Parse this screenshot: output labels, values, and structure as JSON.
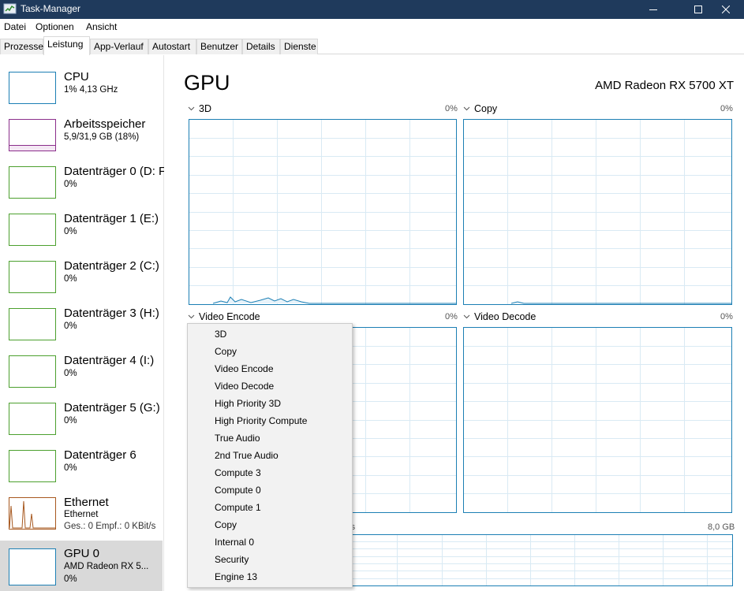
{
  "window": {
    "title": "Task-Manager"
  },
  "menu": [
    "Datei",
    "Optionen",
    "Ansicht"
  ],
  "tabs": [
    "Prozesse",
    "Leistung",
    "App-Verlauf",
    "Autostart",
    "Benutzer",
    "Details",
    "Dienste"
  ],
  "active_tab": "Leistung",
  "sidebar": [
    {
      "title": "CPU",
      "sub": "1% 4,13 GHz",
      "color": "#1c7fb4"
    },
    {
      "title": "Arbeitsspeicher",
      "sub": "5,9/31,9 GB (18%)",
      "color": "#8b2e8b"
    },
    {
      "title": "Datenträger 0 (D: F",
      "sub": "0%",
      "color": "#4ca02e"
    },
    {
      "title": "Datenträger 1 (E:)",
      "sub": "0%",
      "color": "#4ca02e"
    },
    {
      "title": "Datenträger 2 (C:)",
      "sub": "0%",
      "color": "#4ca02e"
    },
    {
      "title": "Datenträger 3 (H:)",
      "sub": "0%",
      "color": "#4ca02e"
    },
    {
      "title": "Datenträger 4 (I:)",
      "sub": "0%",
      "color": "#4ca02e"
    },
    {
      "title": "Datenträger 5 (G:)",
      "sub": "0%",
      "color": "#4ca02e"
    },
    {
      "title": "Datenträger 6",
      "sub": "0%",
      "color": "#4ca02e"
    },
    {
      "title": "Ethernet",
      "sub": "Ethernet",
      "sub2": "Ges.: 0 Empf.: 0 KBit/s",
      "color": "#a7581f"
    },
    {
      "title": "GPU 0",
      "sub": "AMD Radeon RX 5...",
      "sub2": "0%",
      "color": "#1c7fb4"
    }
  ],
  "main": {
    "title": "GPU",
    "gpu_name": "AMD Radeon RX 5700 XT",
    "engines": [
      {
        "label": "3D",
        "percent": "0%"
      },
      {
        "label": "Copy",
        "percent": "0%"
      },
      {
        "label": "Video Encode",
        "percent": "0%"
      },
      {
        "label": "Video Decode",
        "percent": "0%"
      }
    ],
    "memory_partial_label": "rs",
    "memory_max": "8,0 GB"
  },
  "dropdown_items": [
    "3D",
    "Copy",
    "Video Encode",
    "Video Decode",
    "High Priority 3D",
    "High Priority Compute",
    "True Audio",
    "2nd True Audio",
    "Compute 3",
    "Compute 0",
    "Compute 1",
    "Copy",
    "Internal 0",
    "Security",
    "Engine 13"
  ],
  "colors": {
    "accent": "#1c7fb4",
    "titlebar": "#1f3a5c",
    "memory": "#8b2e8b",
    "disk": "#4ca02e",
    "ethernet": "#a7581f"
  }
}
